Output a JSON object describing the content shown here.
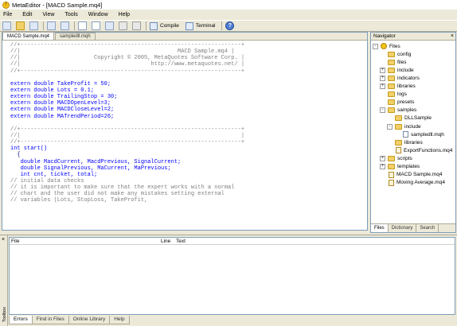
{
  "window": {
    "title": "MetaEditor - [MACD Sample.mq4]"
  },
  "menu": [
    "File",
    "Edit",
    "View",
    "Tools",
    "Window",
    "Help"
  ],
  "toolbar": {
    "compile_label": "Compile",
    "terminal_label": "Terminal"
  },
  "editor": {
    "tabs": [
      "MACD Sample.mq4",
      "sampledll.mqh"
    ],
    "code_lines": [
      {
        "t": "//+------------------------------------------------------------------+",
        "c": "cmt"
      },
      {
        "t": "//|                                               MACD Sample.mq4 |",
        "c": "cmt"
      },
      {
        "t": "//|                      Copyright © 2005, MetaQuotes Software Corp. |",
        "c": "cmt"
      },
      {
        "t": "//|                                       http://www.metaquotes.net/ |",
        "c": "cmt"
      },
      {
        "t": "//+------------------------------------------------------------------+",
        "c": "cmt"
      },
      {
        "t": "",
        "c": "tx"
      },
      {
        "t": "extern double TakeProfit = 50;",
        "c": "kw"
      },
      {
        "t": "extern double Lots = 0.1;",
        "c": "kw"
      },
      {
        "t": "extern double TrailingStop = 30;",
        "c": "kw"
      },
      {
        "t": "extern double MACDOpenLevel=3;",
        "c": "kw"
      },
      {
        "t": "extern double MACDCloseLevel=2;",
        "c": "kw"
      },
      {
        "t": "extern double MATrendPeriod=26;",
        "c": "kw"
      },
      {
        "t": "",
        "c": "tx"
      },
      {
        "t": "//+------------------------------------------------------------------+",
        "c": "cmt"
      },
      {
        "t": "//|                                                                  |",
        "c": "cmt"
      },
      {
        "t": "//+------------------------------------------------------------------+",
        "c": "cmt"
      },
      {
        "t": "int start()",
        "c": "kw"
      },
      {
        "t": "  {",
        "c": "tx"
      },
      {
        "t": "   double MacdCurrent, MacdPrevious, SignalCurrent;",
        "c": "kw"
      },
      {
        "t": "   double SignalPrevious, MaCurrent, MaPrevious;",
        "c": "kw"
      },
      {
        "t": "   int cnt, ticket, total;",
        "c": "kw"
      },
      {
        "t": "// initial data checks",
        "c": "cmt"
      },
      {
        "t": "// it is important to make sure that the expert works with a normal",
        "c": "cmt"
      },
      {
        "t": "// chart and the user did not make any mistakes setting external",
        "c": "cmt"
      },
      {
        "t": "// variables (Lots, StopLoss, TakeProfit,",
        "c": "cmt"
      }
    ]
  },
  "navigator": {
    "title": "Navigator",
    "tree": [
      {
        "label": "Files",
        "indent": 0,
        "icon": "root",
        "exp": "-"
      },
      {
        "label": "config",
        "indent": 1,
        "icon": "folder",
        "exp": ""
      },
      {
        "label": "files",
        "indent": 1,
        "icon": "folder",
        "exp": ""
      },
      {
        "label": "include",
        "indent": 1,
        "icon": "folder",
        "exp": "+"
      },
      {
        "label": "indicators",
        "indent": 1,
        "icon": "folder",
        "exp": "+"
      },
      {
        "label": "libraries",
        "indent": 1,
        "icon": "folder",
        "exp": "+"
      },
      {
        "label": "logs",
        "indent": 1,
        "icon": "folder",
        "exp": ""
      },
      {
        "label": "presets",
        "indent": 1,
        "icon": "folder",
        "exp": ""
      },
      {
        "label": "samples",
        "indent": 1,
        "icon": "folder",
        "exp": "-"
      },
      {
        "label": "DLLSample",
        "indent": 2,
        "icon": "folder",
        "exp": ""
      },
      {
        "label": "include",
        "indent": 2,
        "icon": "folder",
        "exp": "-"
      },
      {
        "label": "sampledll.mqh",
        "indent": 3,
        "icon": "file",
        "exp": ""
      },
      {
        "label": "libraries",
        "indent": 2,
        "icon": "folder",
        "exp": ""
      },
      {
        "label": "ExportFunctions.mq4",
        "indent": 2,
        "icon": "mq4",
        "exp": ""
      },
      {
        "label": "scripts",
        "indent": 1,
        "icon": "folder",
        "exp": "+"
      },
      {
        "label": "templates",
        "indent": 1,
        "icon": "folder",
        "exp": "+"
      },
      {
        "label": "MACD Sample.mq4",
        "indent": 1,
        "icon": "mq4",
        "exp": ""
      },
      {
        "label": "Moving Average.mq4",
        "indent": 1,
        "icon": "mq4",
        "exp": ""
      }
    ],
    "tabs": [
      "Files",
      "Dictionary",
      "Search"
    ]
  },
  "toolbox": {
    "side_label": "Toolbox",
    "columns": {
      "file": "File",
      "line": "Line",
      "text": "Text"
    },
    "tabs": [
      "Errors",
      "Find in Files",
      "Online Library",
      "Help"
    ]
  }
}
